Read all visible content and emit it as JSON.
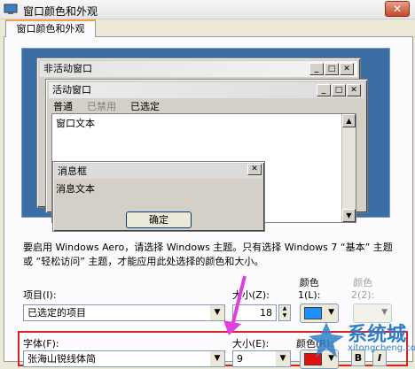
{
  "window": {
    "title": "窗口颜色和外观",
    "close": "✕"
  },
  "tab": {
    "label": "窗口颜色和外观"
  },
  "preview": {
    "inactive": {
      "title": "非活动窗口",
      "min": "_",
      "max": "□",
      "close": "✕"
    },
    "active": {
      "title": "活动窗口",
      "min": "_",
      "max": "□",
      "close": "✕",
      "menu": {
        "normal": "普通",
        "disabled": "已禁用",
        "selected": "已选定"
      },
      "body_text": "窗口文本"
    },
    "message": {
      "title": "消息框",
      "close": "✕",
      "text": "消息文本",
      "ok": "确定"
    }
  },
  "info": "要启用 Windows Aero，请选择 Windows 主题。只有选择 Windows 7 “基本” 主题或 “轻松访问” 主题，才能应用此处选择的颜色和大小。",
  "item": {
    "label": "项目(I):",
    "value": "已选定的项目",
    "size_label": "大小(Z):",
    "size_value": "18",
    "color1_label": "颜色\n1(L):",
    "color2_label": "颜色\n2(2):",
    "color1": "#1e8fff"
  },
  "font": {
    "label": "字体(F):",
    "value": "张海山锐线体简",
    "size_label": "大小(E):",
    "size_value": "9",
    "color_label": "颜色(R):",
    "color": "#e01010",
    "bold": "B",
    "italic": "I"
  },
  "watermark": {
    "text": "系统城",
    "sub": "xitongcheng.com"
  }
}
